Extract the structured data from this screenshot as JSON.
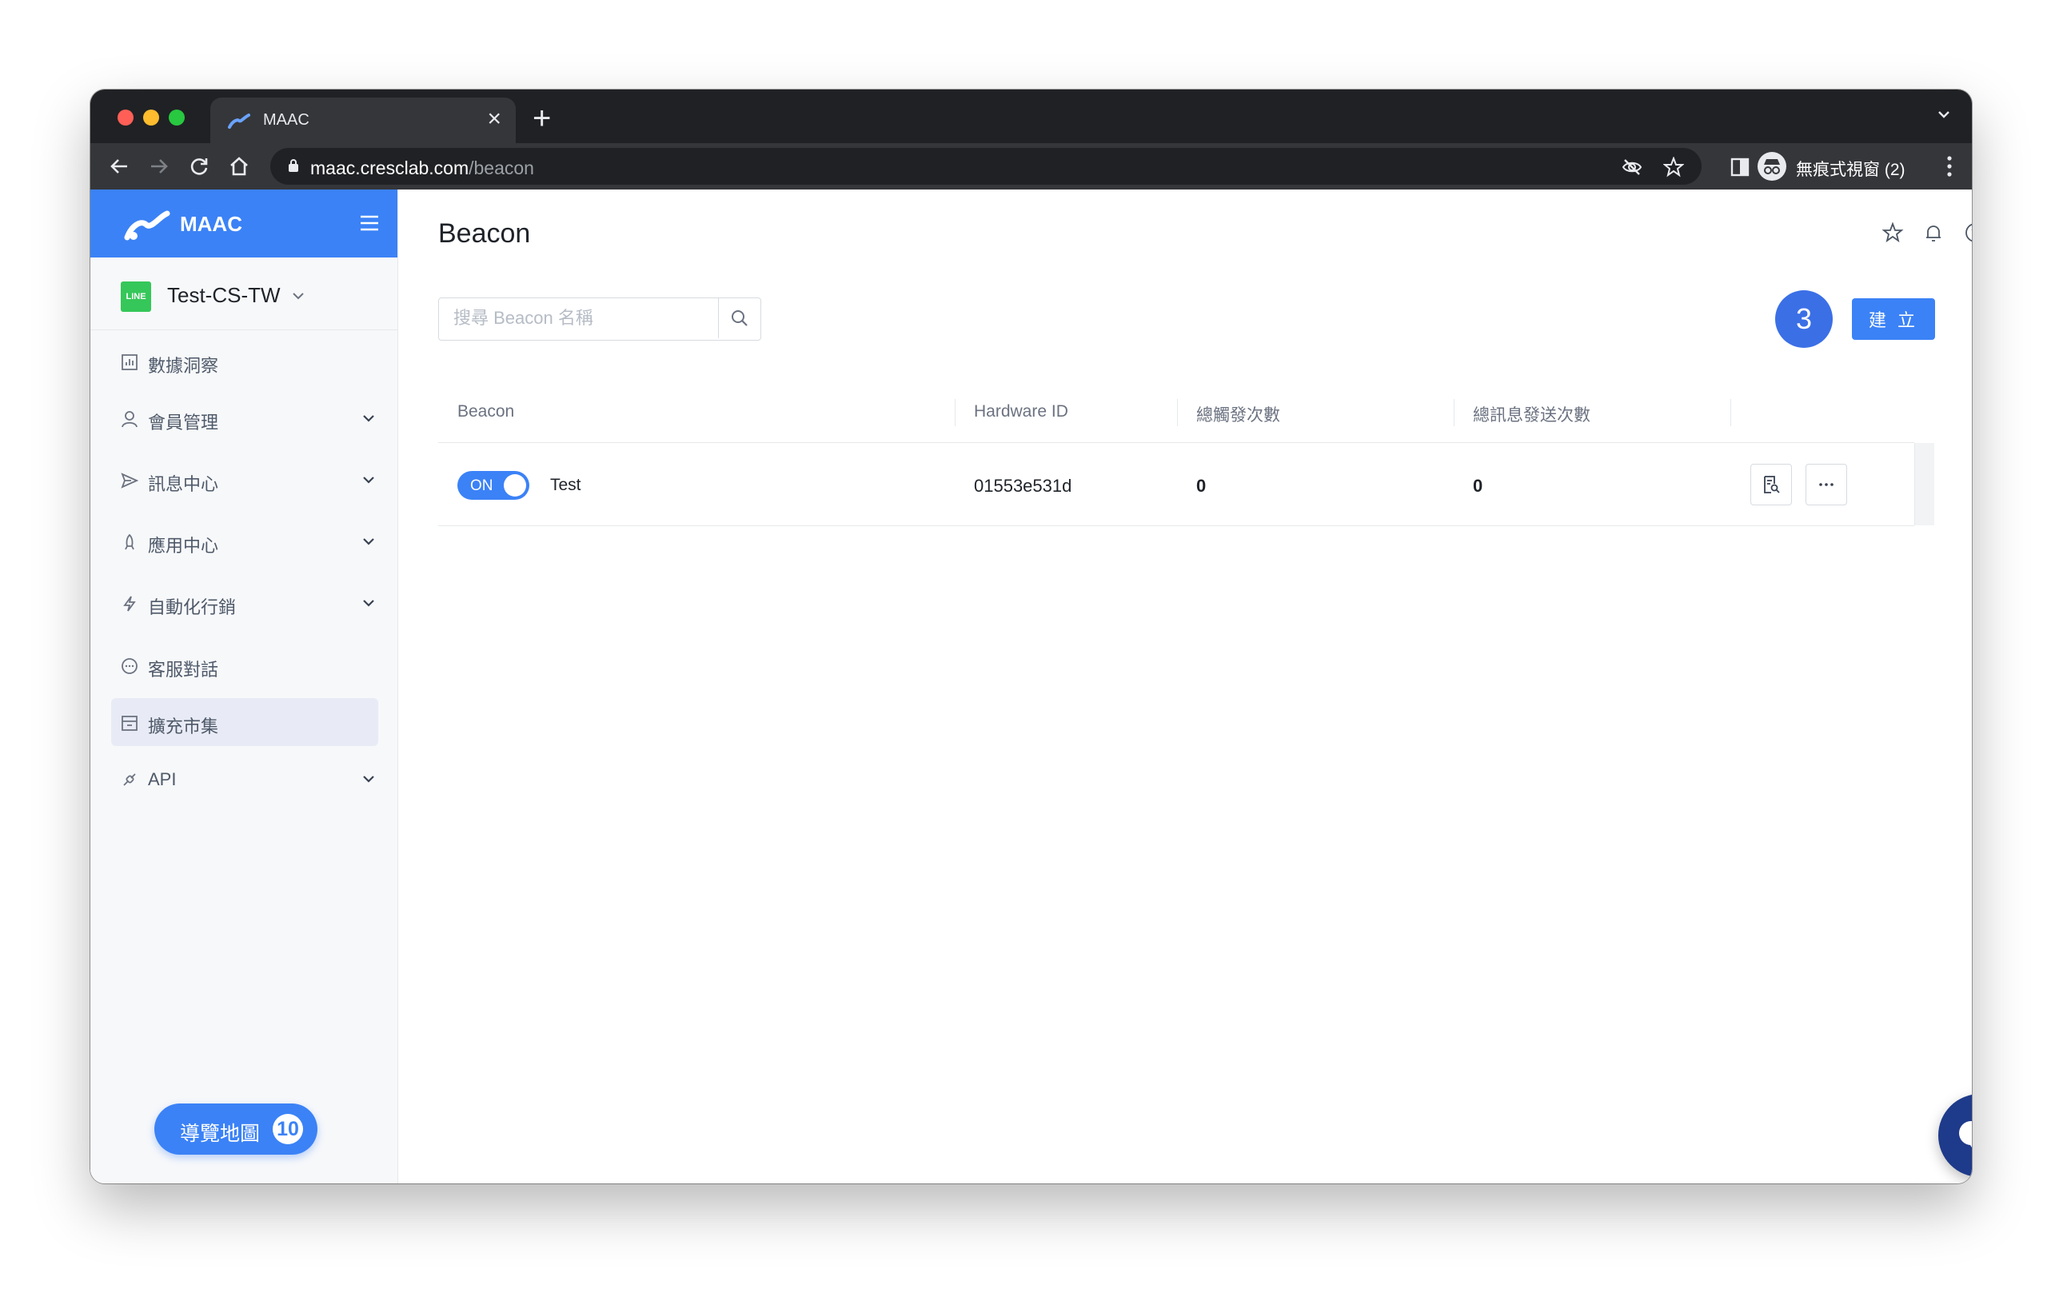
{
  "browser": {
    "tab_title": "MAAC",
    "url_host": "maac.cresclab.com",
    "url_path": "/beacon",
    "profile_label": "無痕式視窗 (2)"
  },
  "sidebar": {
    "brand": "MAAC",
    "account_badge": "LINE",
    "account_name": "Test-CS-TW",
    "items": [
      {
        "label": "數據洞察",
        "icon": "chart-icon",
        "has_chevron": false
      },
      {
        "label": "會員管理",
        "icon": "user-icon",
        "has_chevron": true
      },
      {
        "label": "訊息中心",
        "icon": "send-icon",
        "has_chevron": true
      },
      {
        "label": "應用中心",
        "icon": "rocket-icon",
        "has_chevron": true
      },
      {
        "label": "自動化行銷",
        "icon": "lightning-icon",
        "has_chevron": true
      },
      {
        "label": "客服對話",
        "icon": "chat-icon",
        "has_chevron": false
      },
      {
        "label": "擴充市集",
        "icon": "store-icon",
        "has_chevron": false,
        "active": true
      },
      {
        "label": "API",
        "icon": "api-icon",
        "has_chevron": true
      }
    ],
    "tour_label": "導覽地圖",
    "tour_count": "10"
  },
  "main": {
    "title": "Beacon",
    "search_placeholder": "搜尋 Beacon 名稱",
    "step_badge": "3",
    "create_label": "建 立",
    "columns": [
      "Beacon",
      "Hardware ID",
      "總觸發次數",
      "總訊息發送次數"
    ],
    "rows": [
      {
        "toggle": "ON",
        "name": "Test",
        "hardware_id": "01553e531d",
        "total_triggers": "0",
        "total_messages": "0"
      }
    ]
  },
  "colors": {
    "accent": "#3b82f6",
    "step_badge": "#3b6fe6",
    "chat_fab": "#1e3a8a"
  }
}
